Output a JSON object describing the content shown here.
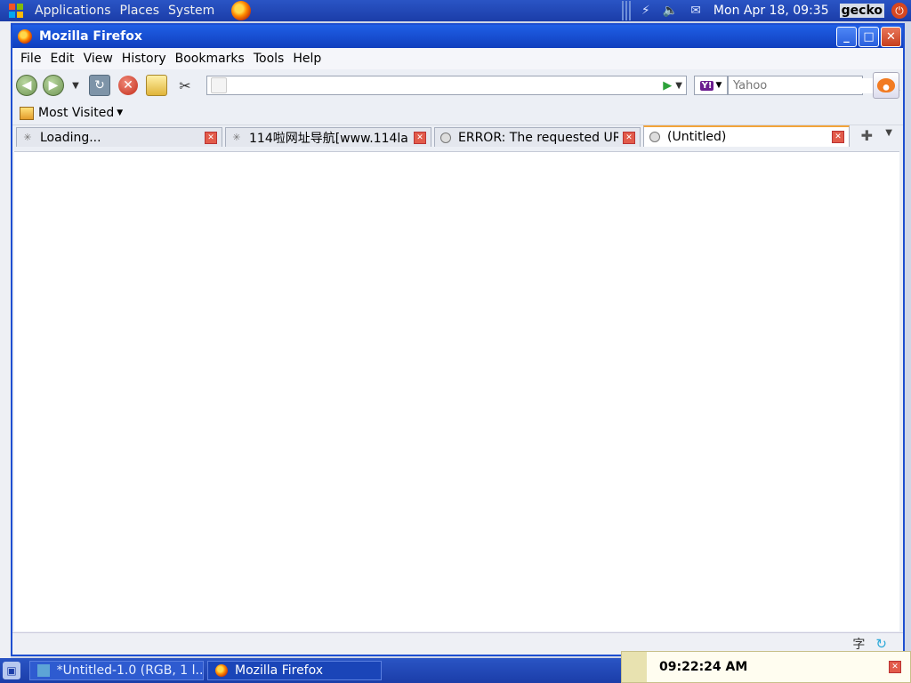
{
  "top_panel": {
    "menus": [
      "Applications",
      "Places",
      "System"
    ],
    "datetime": "Mon Apr 18, 09:35",
    "user": "gecko"
  },
  "window": {
    "title": "Mozilla Firefox",
    "buttons": {
      "minimize": "_",
      "maximize": "□",
      "close": "✕"
    }
  },
  "menubar": {
    "items": [
      "File",
      "Edit",
      "View",
      "History",
      "Bookmarks",
      "Tools",
      "Help"
    ]
  },
  "navbar": {
    "url_value": "",
    "search_placeholder": "Yahoo",
    "search_engine_logo": "Y!"
  },
  "bookmarks": {
    "most_visited": "Most Visited"
  },
  "tabs": [
    {
      "label": "Loading...",
      "icon": "loading-icon",
      "active": false
    },
    {
      "label": "114啦网址导航[www.114la....",
      "icon": "loading-icon",
      "active": false
    },
    {
      "label": "ERROR: The requested UR...",
      "icon": "page-icon",
      "active": false
    },
    {
      "label": "(Untitled)",
      "icon": "page-icon",
      "active": true
    }
  ],
  "statusbar": {
    "ime_glyph": "字"
  },
  "taskbar": {
    "tasks": [
      {
        "label": "*Untitled-1.0 (RGB, 1 l...",
        "active": false
      },
      {
        "label": "Mozilla Firefox",
        "active": true
      }
    ],
    "clock": "09:22:24 AM"
  },
  "colors": {
    "panel_blue": "#1b3da8",
    "titlebar_blue": "#1f5fe6",
    "active_tab_accent": "#f2a43a"
  }
}
